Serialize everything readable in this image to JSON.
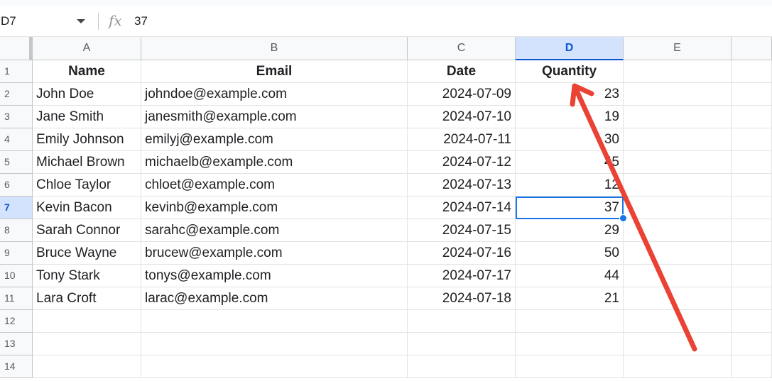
{
  "formula_bar": {
    "cell_ref": "D7",
    "fx_label": "fx",
    "formula_value": "37"
  },
  "columns": [
    {
      "label": "A",
      "selected": false
    },
    {
      "label": "B",
      "selected": false
    },
    {
      "label": "C",
      "selected": false
    },
    {
      "label": "D",
      "selected": true
    },
    {
      "label": "E",
      "selected": false
    }
  ],
  "rows": [
    "1",
    "2",
    "3",
    "4",
    "5",
    "6",
    "7",
    "8",
    "9",
    "10",
    "11",
    "12",
    "13",
    "14"
  ],
  "selected_row": "7",
  "table": {
    "headers": [
      "Name",
      "Email",
      "Date",
      "Quantity"
    ],
    "records": [
      [
        "John Doe",
        "johndoe@example.com",
        "2024-07-09",
        "23"
      ],
      [
        "Jane Smith",
        "janesmith@example.com",
        "2024-07-10",
        "19"
      ],
      [
        "Emily Johnson",
        "emilyj@example.com",
        "2024-07-11",
        "30"
      ],
      [
        "Michael Brown",
        "michaelb@example.com",
        "2024-07-12",
        "45"
      ],
      [
        "Chloe Taylor",
        "chloet@example.com",
        "2024-07-13",
        "12"
      ],
      [
        "Kevin Bacon",
        "kevinb@example.com",
        "2024-07-14",
        "37"
      ],
      [
        "Sarah Connor",
        "sarahc@example.com",
        "2024-07-15",
        "29"
      ],
      [
        "Bruce Wayne",
        "brucew@example.com",
        "2024-07-16",
        "50"
      ],
      [
        "Tony Stark",
        "tonys@example.com",
        "2024-07-17",
        "44"
      ],
      [
        "Lara Croft",
        "larac@example.com",
        "2024-07-18",
        "21"
      ]
    ]
  },
  "annotation": {
    "color": "#ea4335"
  },
  "colors": {
    "selection": "#1a73e8",
    "header_selected_bg": "#d3e3fd"
  }
}
